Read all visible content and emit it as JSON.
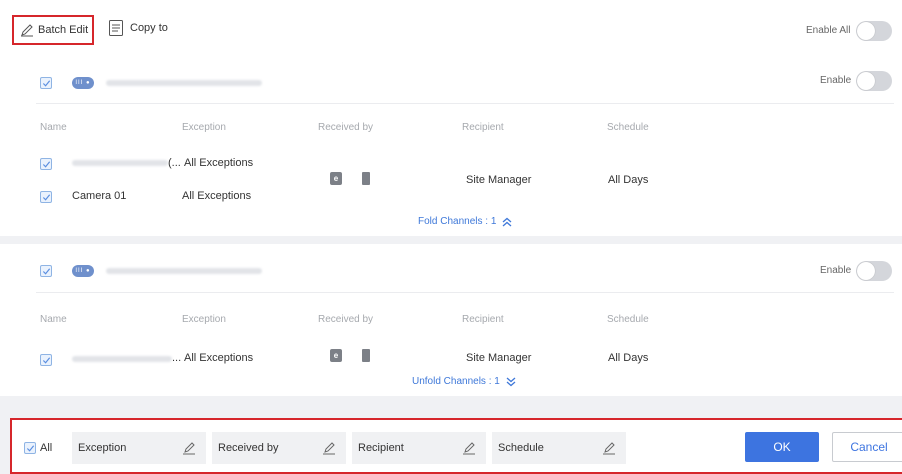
{
  "toolbar": {
    "batch_edit_label": "Batch Edit",
    "copy_to_label": "Copy to",
    "enable_all_label": "Enable All"
  },
  "device_icon_text": "III ●",
  "groups": [
    {
      "enable_label": "Enable",
      "headers": {
        "name": "Name",
        "exception": "Exception",
        "received_by": "Received by",
        "recipient": "Recipient",
        "schedule": "Schedule"
      },
      "rows": [
        {
          "name_suffix": "(...",
          "exception": "All Exceptions"
        },
        {
          "name": "Camera 01",
          "exception": "All Exceptions"
        }
      ],
      "recipient": "Site Manager",
      "schedule": "All Days",
      "fold_label": "Fold Channels : 1"
    },
    {
      "enable_label": "Enable",
      "headers": {
        "name": "Name",
        "exception": "Exception",
        "received_by": "Received by",
        "recipient": "Recipient",
        "schedule": "Schedule"
      },
      "rows": [
        {
          "name_suffix": "...",
          "exception": "All Exceptions"
        }
      ],
      "recipient": "Site Manager",
      "schedule": "All Days",
      "fold_label": "Unfold Channels : 1"
    }
  ],
  "bottom": {
    "all_label": "All",
    "fields": [
      "Exception",
      "Received by",
      "Recipient",
      "Schedule"
    ],
    "ok_label": "OK",
    "cancel_label": "Cancel"
  },
  "colors": {
    "accent": "#3d74e0",
    "highlight": "#d6262b"
  }
}
